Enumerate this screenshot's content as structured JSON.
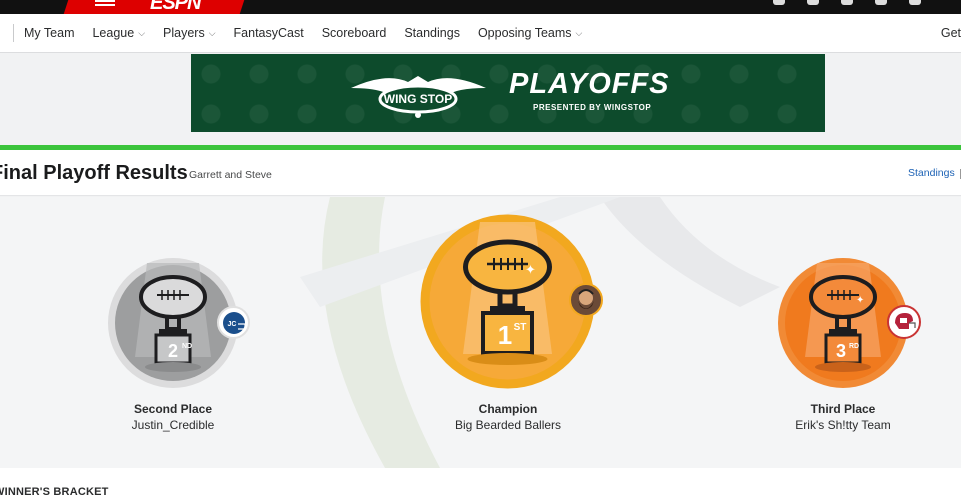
{
  "topbar": {
    "logo_text": "ESPN",
    "icons": [
      "user-icon",
      "gear-icon",
      "search-icon",
      "notification-icon",
      "help-icon"
    ]
  },
  "subnav": {
    "items": [
      {
        "label": "My Team",
        "has_dropdown": false
      },
      {
        "label": "League",
        "has_dropdown": true
      },
      {
        "label": "Players",
        "has_dropdown": true
      },
      {
        "label": "FantasyCast",
        "has_dropdown": false
      },
      {
        "label": "Scoreboard",
        "has_dropdown": false
      },
      {
        "label": "Standings",
        "has_dropdown": false
      },
      {
        "label": "Opposing Teams",
        "has_dropdown": true
      }
    ],
    "overflow_label": "Get"
  },
  "banner": {
    "brand": "WING STOP",
    "title": "PLAYOFFS",
    "subtitle": "PRESENTED BY WINGSTOP",
    "bg_color": "#0d4b2c"
  },
  "results": {
    "title": "Final Playoff Results",
    "owners": "Garrett and Steve",
    "standings_link": "Standings"
  },
  "podium": {
    "champion": {
      "label": "Champion",
      "team": "Big Bearded Ballers",
      "rank_text": "1",
      "rank_suffix": "ST",
      "color": "#f5a623"
    },
    "second": {
      "label": "Second Place",
      "team": "Justin_Credible",
      "rank_text": "2",
      "rank_suffix": "ND",
      "color": "#9b9c9e"
    },
    "third": {
      "label": "Third Place",
      "team": "Erik's Sh!tty Team",
      "rank_text": "3",
      "rank_suffix": "RD",
      "color": "#f07a1e"
    }
  },
  "bracket": {
    "title": "WINNER'S BRACKET"
  },
  "colors": {
    "accent_green": "#3bc43b",
    "link_blue": "#1d62b5",
    "espn_red": "#dd0000"
  }
}
